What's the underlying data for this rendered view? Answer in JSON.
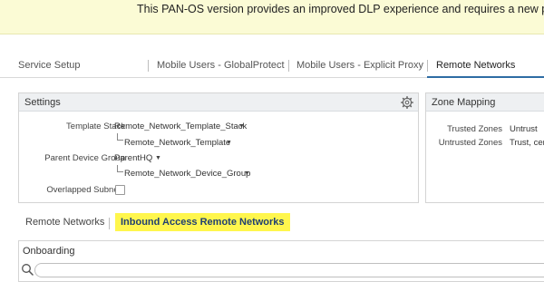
{
  "banner": {
    "text": "This PAN-OS version provides an improved DLP experience and requires a new plugi"
  },
  "top_tabs": [
    {
      "label": "Service Setup"
    },
    {
      "label": "Mobile Users - GlobalProtect"
    },
    {
      "label": "Mobile Users - Explicit Proxy"
    },
    {
      "label": "Remote Networks"
    }
  ],
  "settings": {
    "title": "Settings",
    "icon": "gear-icon",
    "template_stack_label": "Template Stack",
    "template_stack_value": "Remote_Network_Template_Stack",
    "template_value": "Remote_Network_Template",
    "parent_device_group_label": "Parent Device Group",
    "parent_device_group_value": "ParentHQ",
    "device_group_value": "Remote_Network_Device_Group",
    "overlapped_subnets_label": "Overlapped Subnets",
    "overlapped_subnets_checked": false
  },
  "zone_mapping": {
    "title": "Zone Mapping",
    "trusted_label": "Trusted Zones",
    "trusted_value": "Untrust",
    "untrusted_label": "Untrusted Zones",
    "untrusted_value": "Trust, cent"
  },
  "sub_tabs": [
    {
      "label": "Remote Networks"
    },
    {
      "label": "Inbound Access Remote Networks"
    }
  ],
  "onboarding": {
    "title": "Onboarding",
    "search_placeholder": "",
    "search_icon": "search-icon"
  },
  "colors": {
    "banner_bg": "#fbfbd5",
    "highlight": "#fff64d",
    "highlight_text": "#1f3f72",
    "active_tab_rule": "#2e6ca4"
  }
}
